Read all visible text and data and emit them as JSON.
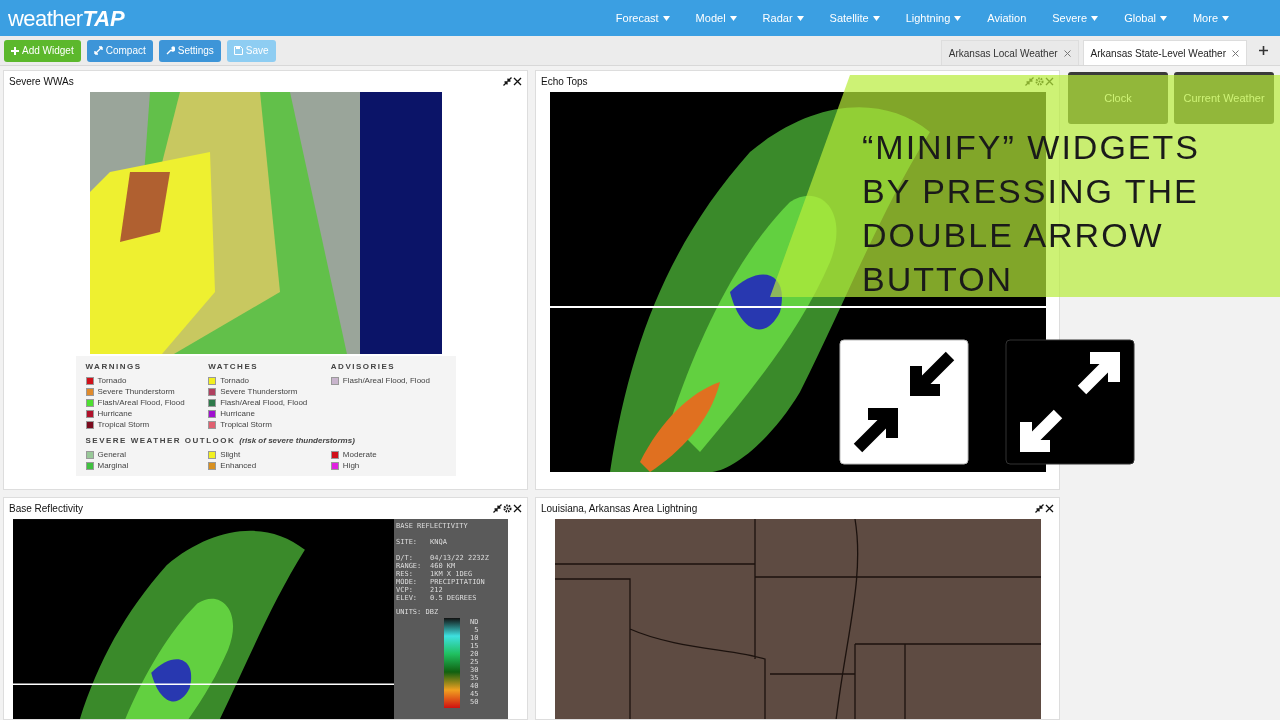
{
  "nav": {
    "logo": {
      "light": "weather",
      "bold": "TAP"
    },
    "items": [
      {
        "label": "Forecast",
        "dropdown": true
      },
      {
        "label": "Model",
        "dropdown": true
      },
      {
        "label": "Radar",
        "dropdown": true
      },
      {
        "label": "Satellite",
        "dropdown": true
      },
      {
        "label": "Lightning",
        "dropdown": true
      },
      {
        "label": "Aviation",
        "dropdown": false
      },
      {
        "label": "Severe",
        "dropdown": true
      },
      {
        "label": "Global",
        "dropdown": true
      },
      {
        "label": "More",
        "dropdown": true
      }
    ]
  },
  "toolbar": {
    "buttons": [
      {
        "label": "Add Widget",
        "kind": "add"
      },
      {
        "label": "Compact",
        "kind": "compact"
      },
      {
        "label": "Settings",
        "kind": "settings"
      },
      {
        "label": "Save",
        "kind": "save"
      }
    ],
    "tabs": [
      {
        "label": "Arkansas Local Weather",
        "selected": false
      },
      {
        "label": "Arkansas State-Level Weather",
        "selected": true
      }
    ]
  },
  "widgets": [
    {
      "title": "Severe WWAs",
      "kind": "wwa",
      "settings": false,
      "legend": {
        "groups": [
          {
            "heading": "WARNINGS",
            "items": [
              {
                "label": "Tornado",
                "color": "#d0101a"
              },
              {
                "label": "Severe Thunderstorm",
                "color": "#e08a2a"
              },
              {
                "label": "Flash/Areal Flood, Flood",
                "color": "#4ee030"
              },
              {
                "label": "Hurricane",
                "color": "#b0102a"
              },
              {
                "label": "Tropical Storm",
                "color": "#7a0a1e"
              }
            ]
          },
          {
            "heading": "WATCHES",
            "items": [
              {
                "label": "Tornado",
                "color": "#f2f020"
              },
              {
                "label": "Severe Thunderstorm",
                "color": "#b04060"
              },
              {
                "label": "Flash/Areal Flood, Flood",
                "color": "#2e7a4a"
              },
              {
                "label": "Hurricane",
                "color": "#a010d0"
              },
              {
                "label": "Tropical Storm",
                "color": "#e06070"
              }
            ]
          },
          {
            "heading": "ADVISORIES",
            "items": [
              {
                "label": "Flash/Areal Flood, Flood",
                "color": "#c8b4cc"
              }
            ]
          }
        ],
        "outlook_heading": "SEVERE WEATHER OUTLOOK",
        "outlook_note": "(risk of severe thunderstorms)",
        "outlook": [
          {
            "label": "General",
            "color": "#98c898"
          },
          {
            "label": "Slight",
            "color": "#f2f020"
          },
          {
            "label": "Moderate",
            "color": "#d0101a"
          },
          {
            "label": "Marginal",
            "color": "#40c040"
          },
          {
            "label": "Enhanced",
            "color": "#d89020"
          },
          {
            "label": "High",
            "color": "#e020e0"
          }
        ]
      }
    },
    {
      "title": "Echo Tops",
      "kind": "radar",
      "settings": true
    },
    {
      "title": "Base Reflectivity",
      "kind": "reflectivity",
      "settings": true,
      "panel": {
        "heading": "BASE REFLECTIVITY",
        "lines": [
          {
            "key": "SITE:",
            "value": "KNQA"
          },
          {
            "key": "D/T:",
            "value": "04/13/22 2232Z"
          },
          {
            "key": "RANGE:",
            "value": "460 KM"
          },
          {
            "key": "RES:",
            "value": "1KM X 1DEG"
          },
          {
            "key": "MODE:",
            "value": "PRECIPITATION"
          },
          {
            "key": "VCP:",
            "value": "212"
          },
          {
            "key": "ELEV:",
            "value": "0.5 DEGREES"
          }
        ],
        "units": "UNITS: DBZ",
        "scale": [
          "ND",
          "5",
          "10",
          "15",
          "20",
          "25",
          "30",
          "35",
          "40",
          "45",
          "50"
        ]
      }
    },
    {
      "title": "Louisiana, Arkansas Area Lightning",
      "kind": "lightning",
      "settings": false
    }
  ],
  "minimized": [
    {
      "title": "Clock"
    },
    {
      "title": "Current Weather"
    }
  ],
  "overlay": {
    "caption": "“MINIFY” WIDGETS BY PRESSING THE DOUBLE ARROW BUTTON"
  }
}
